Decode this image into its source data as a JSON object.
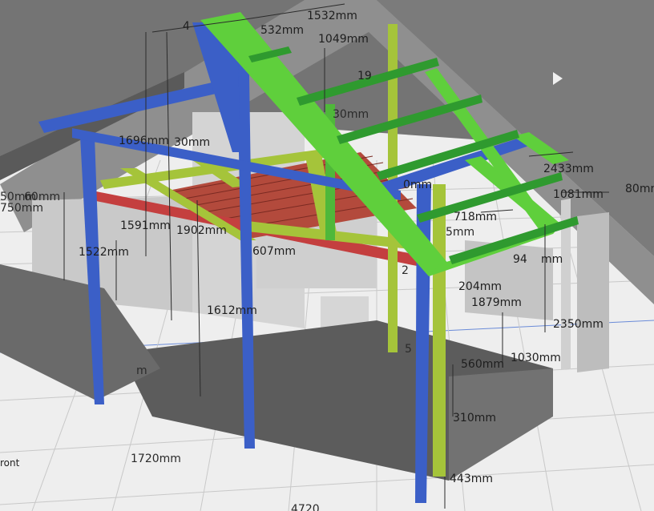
{
  "viewport": {
    "view_label": "ront",
    "colors": {
      "post": "#3b5fc7",
      "rafter": "#5fcf3c",
      "purlin": "#2f9a2f",
      "joist": "#a5c43a",
      "deck": "#b34a3c",
      "beam_red": "#c43f3f",
      "wall": "#c9c9c9",
      "roof": "#8f8f8f",
      "floor": "#eeeeee"
    }
  },
  "dimensions": [
    {
      "id": "d1",
      "text": "1532mm"
    },
    {
      "id": "d2",
      "text": "532mm"
    },
    {
      "id": "d3",
      "text": "1049mm"
    },
    {
      "id": "d4",
      "text": "19"
    },
    {
      "id": "d5",
      "text": "4"
    },
    {
      "id": "d6",
      "text": "1696mm"
    },
    {
      "id": "d7",
      "text": "30mm"
    },
    {
      "id": "d8",
      "text": "80mm"
    },
    {
      "id": "d9",
      "text": "2433mm"
    },
    {
      "id": "d10",
      "text": "1081mm"
    },
    {
      "id": "d11",
      "text": "0mm"
    },
    {
      "id": "d12",
      "text": "1591mm"
    },
    {
      "id": "d13",
      "text": "1902mm"
    },
    {
      "id": "d14",
      "text": "1522mm"
    },
    {
      "id": "d15",
      "text": "607mm"
    },
    {
      "id": "d16",
      "text": "718mm"
    },
    {
      "id": "d17",
      "text": "94"
    },
    {
      "id": "d18",
      "text": "mm"
    },
    {
      "id": "d19",
      "text": "204mm"
    },
    {
      "id": "d20",
      "text": "1879mm"
    },
    {
      "id": "d21",
      "text": "1612mm"
    },
    {
      "id": "d22",
      "text": "2350mm"
    },
    {
      "id": "d23",
      "text": "1030mm"
    },
    {
      "id": "d24",
      "text": "560mm"
    },
    {
      "id": "d25",
      "text": "310mm"
    },
    {
      "id": "d26",
      "text": "1720mm"
    },
    {
      "id": "d27",
      "text": "443mm"
    },
    {
      "id": "d28",
      "text": "4720"
    },
    {
      "id": "d29",
      "text": "50mm"
    },
    {
      "id": "d30",
      "text": "60mm"
    },
    {
      "id": "d31",
      "text": "750mm"
    },
    {
      "id": "d32",
      "text": "m"
    },
    {
      "id": "d33",
      "text": "2"
    },
    {
      "id": "d34",
      "text": "5"
    },
    {
      "id": "d35",
      "text": "30mm"
    },
    {
      "id": "d36",
      "text": "5mm"
    }
  ]
}
